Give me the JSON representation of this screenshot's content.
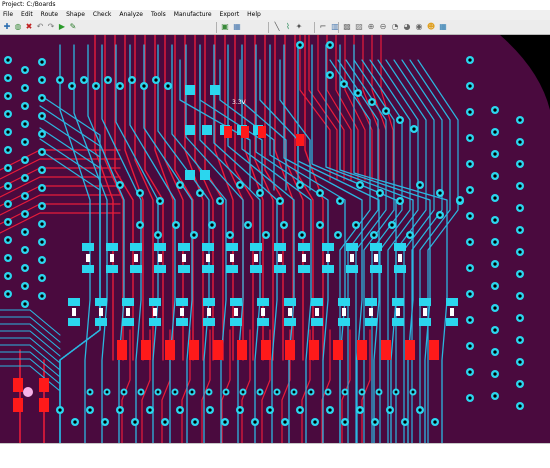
{
  "window": {
    "title": "Project: C:/Boards"
  },
  "menu": {
    "items": [
      "File",
      "Edit",
      "Route",
      "Shape",
      "Check",
      "Analyze",
      "Tools",
      "Manufacture",
      "Export",
      "Help"
    ]
  },
  "toolbar": {
    "groups": [
      [
        "cursor-icon",
        "circle-icon",
        "delete-icon",
        "undo-icon",
        "redo-icon",
        "route-icon",
        "pin-icon"
      ],
      [
        "layers-icon",
        "grid-icon"
      ],
      [
        "line-icon",
        "wire-icon",
        "via-icon"
      ],
      [
        "snap-icon",
        "measure-icon"
      ],
      [
        "zoom-fit-icon",
        "zoom-window-icon",
        "zoom-in-icon",
        "zoom-out-icon",
        "zoom-prev-icon",
        "zoom-next-icon",
        "zoom-all-icon",
        "highlight-icon",
        "color-icon"
      ]
    ]
  },
  "canvas": {
    "board_label": "3.3V",
    "colors": {
      "background": "#000000",
      "board": "#4a0a3e",
      "top_layer": "#e81c3a",
      "bottom_layer": "#2bb6e0",
      "pads": "#2bd6ee",
      "smd_pads": "#ff1a1a",
      "silk": "#ffffff",
      "via_hole": "#000000",
      "highlight_pad": "#f7b3e8"
    }
  }
}
